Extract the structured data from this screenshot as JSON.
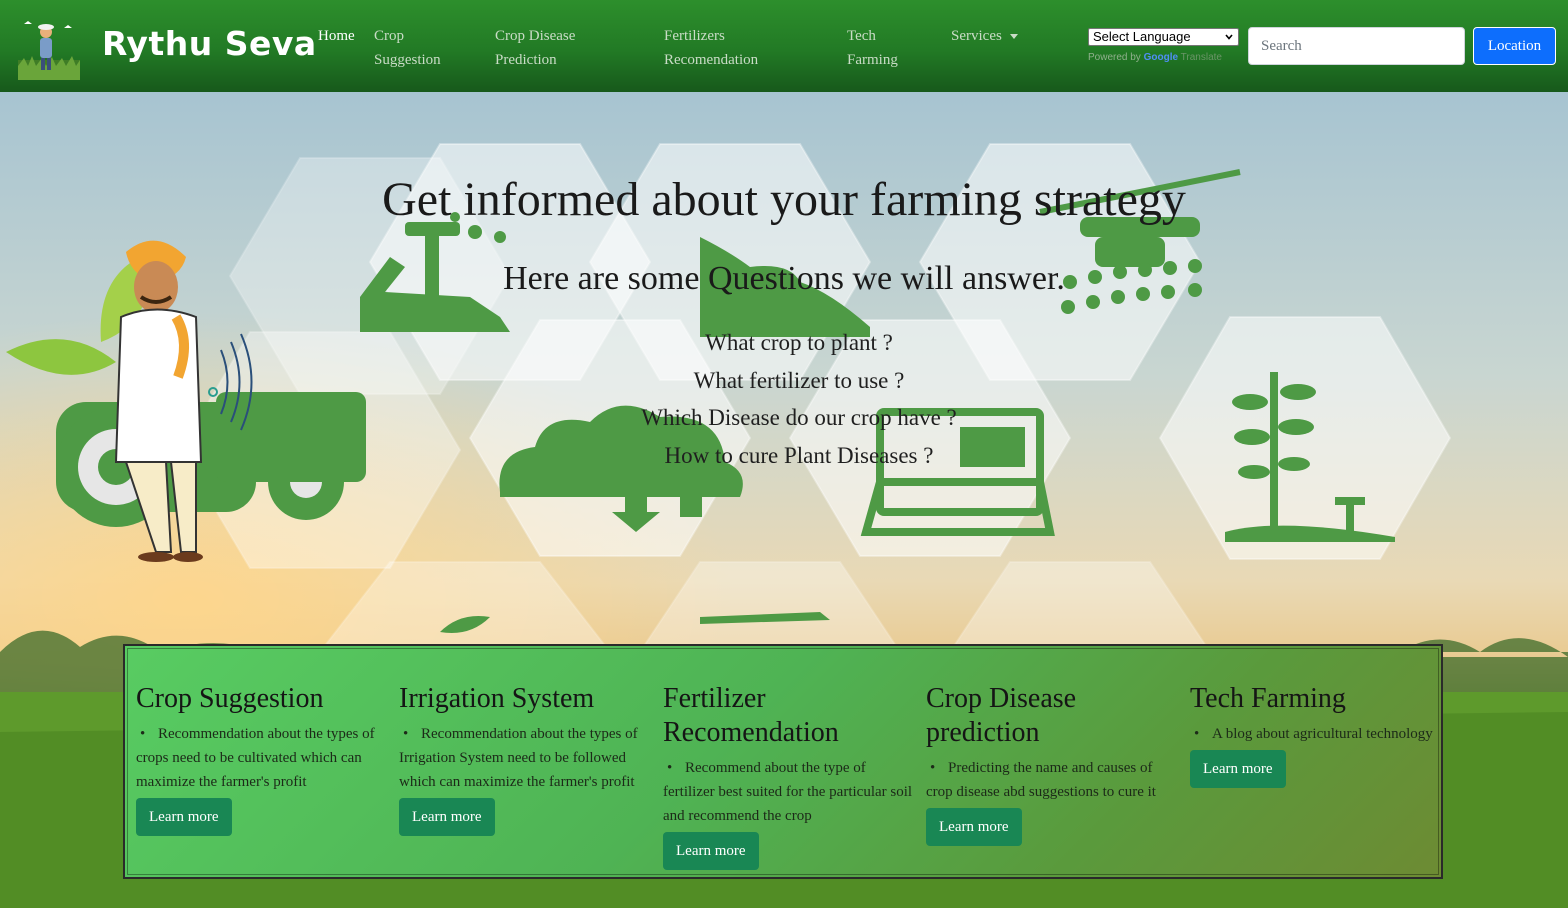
{
  "navbar": {
    "brand": "Rythu Seva",
    "links": [
      {
        "label": "Home",
        "active": true
      },
      {
        "label": "Crop",
        "label2": "Suggestion"
      },
      {
        "label": "Crop Disease",
        "label2": "Prediction"
      },
      {
        "label": "Fertilizers",
        "label2": "Recomendation"
      },
      {
        "label": "Tech",
        "label2": "Farming"
      },
      {
        "label": "Services",
        "dropdown": true
      }
    ],
    "language": {
      "selected": "Select Language",
      "powered_prefix": "Powered by",
      "powered_brand": "Google",
      "powered_suffix": "Translate"
    },
    "search": {
      "placeholder": "Search"
    },
    "location_label": "Location"
  },
  "hero": {
    "title": "Get informed about your farming strategy",
    "subtitle": "Here are some Questions we will answer.",
    "questions": [
      "What crop to plant ?",
      "What fertilizer to use ?",
      "Which Disease do our crop have ?",
      "How to cure Plant Diseases ?"
    ]
  },
  "cards": [
    {
      "title": "Crop Suggestion",
      "description": "Recommendation about the types of crops need to be cultivated which can maximize the farmer's profit",
      "button": "Learn more"
    },
    {
      "title": "Irrigation System",
      "description": "Recommendation about the types of Irrigation System need to be followed which can maximize the farmer's profit",
      "button": "Learn more"
    },
    {
      "title": "Fertilizer Recomendation",
      "description": "Recommend about the type of fertilizer best suited for the particular soil and recommend the crop",
      "button": "Learn more"
    },
    {
      "title": "Crop Disease prediction",
      "description": "Predicting the name and causes of crop disease abd suggestions to cure it",
      "button": "Learn more"
    },
    {
      "title": "Tech Farming",
      "description": "A blog about agricultural technology",
      "button": "Learn more"
    }
  ],
  "colors": {
    "nav_green": "#227a25",
    "button_green": "#198754",
    "location_blue": "#0d6efd",
    "icon_green": "#4e9a45"
  }
}
